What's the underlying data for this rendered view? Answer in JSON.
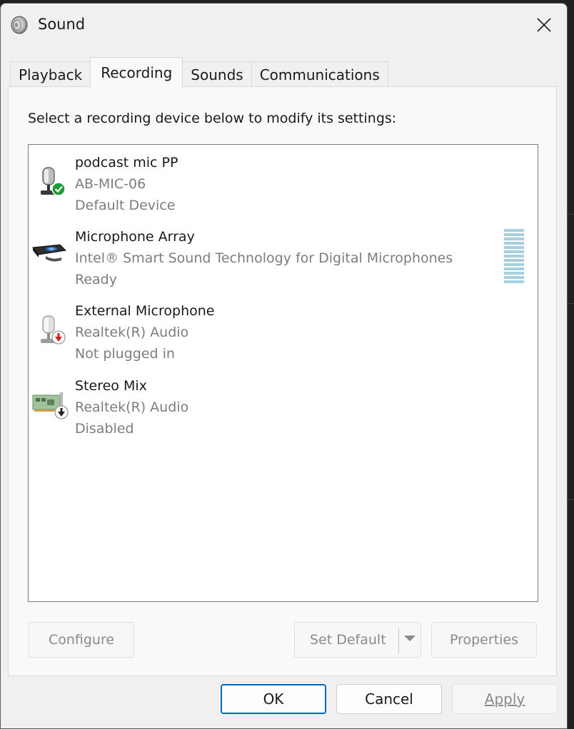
{
  "window": {
    "title": "Sound",
    "close_icon": "close-icon",
    "app_icon": "speaker-icon"
  },
  "tabs": [
    {
      "label": "Playback",
      "active": false
    },
    {
      "label": "Recording",
      "active": true
    },
    {
      "label": "Sounds",
      "active": false
    },
    {
      "label": "Communications",
      "active": false
    }
  ],
  "panel": {
    "instructions": "Select a recording device below to modify its settings:"
  },
  "devices": [
    {
      "name": "podcast mic PP",
      "description": "AB-MIC-06",
      "status": "Default Device",
      "icon": "microphone-icon",
      "badge": "check-badge-icon"
    },
    {
      "name": "Microphone Array",
      "description": "Intel® Smart Sound Technology for Digital Microphones",
      "status": "Ready",
      "icon": "webcam-microphone-icon",
      "badge": ""
    },
    {
      "name": "External Microphone",
      "description": "Realtek(R) Audio",
      "status": "Not plugged in",
      "icon": "microphone-icon",
      "badge": "unplugged-badge-icon"
    },
    {
      "name": "Stereo Mix",
      "description": "Realtek(R) Audio",
      "status": "Disabled",
      "icon": "sound-card-icon",
      "badge": "disabled-badge-icon"
    }
  ],
  "buttons": {
    "configure": "Configure",
    "set_default": "Set Default",
    "properties": "Properties",
    "ok": "OK",
    "cancel": "Cancel",
    "apply": "Apply"
  },
  "colors": {
    "ok_border": "#0067c0",
    "default_badge": "#1e9b34",
    "unplugged_badge": "#d21f1f",
    "level_meter": "#a7cfe0"
  }
}
